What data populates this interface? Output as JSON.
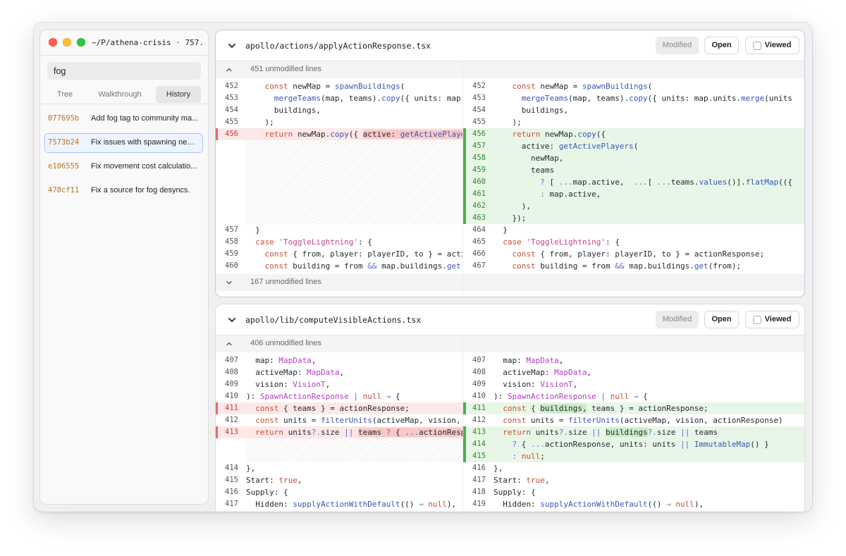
{
  "window": {
    "title": "~/P/athena-crisis · 757..."
  },
  "sidebar": {
    "search_value": "fog",
    "tabs": [
      "Tree",
      "Walkthrough",
      "History"
    ],
    "active_tab": "History",
    "commits": [
      {
        "hash": "077695b",
        "message": "Add fog tag to community ma..."
      },
      {
        "hash": "7573b24",
        "message": "Fix issues with spawning new ..."
      },
      {
        "hash": "e106555",
        "message": "Fix movement cost calculatio..."
      },
      {
        "hash": "470cf11",
        "message": "Fix a source for fog desyncs."
      }
    ],
    "selected_commit": "7573b24"
  },
  "files": [
    {
      "path": "apollo/actions/applyActionResponse.tsx",
      "status": "Modified",
      "open_label": "Open",
      "viewed_label": "Viewed",
      "fold_top": "451 unmodified lines",
      "fold_bottom": "167 unmodified lines",
      "left": [
        {
          "n": "452",
          "type": "ctx",
          "html": "    <span class='k'>const</span> newMap = <span class='f'>spawnBuildings</span>("
        },
        {
          "n": "453",
          "type": "ctx",
          "html": "      <span class='f'>mergeTeams</span>(map, teams).<span class='f'>copy</span>({ units: map.units.merge("
        },
        {
          "n": "454",
          "type": "ctx",
          "html": "      buildings,"
        },
        {
          "n": "455",
          "type": "ctx",
          "html": "    );"
        },
        {
          "n": "456",
          "type": "del",
          "html": "    <span class='k'>return</span> newMap.<span class='f'>copy</span>({ <span class='hlr'>active: <span class='f'>getActivePlayers</span></span>"
        },
        {
          "n": "",
          "type": "empty",
          "html": ""
        },
        {
          "n": "",
          "type": "empty",
          "html": ""
        },
        {
          "n": "",
          "type": "empty",
          "html": ""
        },
        {
          "n": "",
          "type": "empty",
          "html": ""
        },
        {
          "n": "",
          "type": "empty",
          "html": ""
        },
        {
          "n": "",
          "type": "empty",
          "html": ""
        },
        {
          "n": "",
          "type": "empty",
          "html": ""
        },
        {
          "n": "457",
          "type": "ctx",
          "html": "  }"
        },
        {
          "n": "458",
          "type": "ctx",
          "html": "  <span class='k'>case</span> <span class='s'>'ToggleLightning'</span>: {"
        },
        {
          "n": "459",
          "type": "ctx",
          "html": "    <span class='k'>const</span> { from, player: playerID, to } = actionResponse;"
        },
        {
          "n": "460",
          "type": "ctx",
          "html": "    <span class='k'>const</span> building = from <span class='o'>&amp;&amp;</span> map.buildings.<span class='f'>get</span>(from);"
        }
      ],
      "right": [
        {
          "n": "452",
          "type": "ctx",
          "html": "    <span class='k'>const</span> newMap = <span class='f'>spawnBuildings</span>("
        },
        {
          "n": "453",
          "type": "ctx",
          "html": "      <span class='f'>mergeTeams</span>(map, teams).<span class='f'>copy</span>({ units: map.units.<span class='f'>merge</span>(units"
        },
        {
          "n": "454",
          "type": "ctx",
          "html": "      buildings,"
        },
        {
          "n": "455",
          "type": "ctx",
          "html": "    );"
        },
        {
          "n": "456",
          "type": "add",
          "html": "    <span class='k'>return</span> newMap.<span class='f'>copy</span>({"
        },
        {
          "n": "457",
          "type": "add",
          "html": "      active: <span class='f'>getActivePlayers</span>("
        },
        {
          "n": "458",
          "type": "add",
          "html": "        newMap,"
        },
        {
          "n": "459",
          "type": "add",
          "html": "        teams"
        },
        {
          "n": "460",
          "type": "add",
          "html": "          <span class='o'>?</span> [ <span class='o'>...</span>map.active,  <span class='o'>...</span>[ <span class='o'>...</span>teams.<span class='f'>values</span>()].<span class='f'>flatMap</span>(({"
        },
        {
          "n": "461",
          "type": "add",
          "html": "          <span class='o'>:</span> map.active,"
        },
        {
          "n": "462",
          "type": "add",
          "html": "      ),"
        },
        {
          "n": "463",
          "type": "add",
          "html": "    });"
        },
        {
          "n": "464",
          "type": "ctx",
          "html": "  }"
        },
        {
          "n": "465",
          "type": "ctx",
          "html": "  <span class='k'>case</span> <span class='s'>'ToggleLightning'</span>: {"
        },
        {
          "n": "466",
          "type": "ctx",
          "html": "    <span class='k'>const</span> { from, player: playerID, to } = actionResponse;"
        },
        {
          "n": "467",
          "type": "ctx",
          "html": "    <span class='k'>const</span> building = from <span class='o'>&amp;&amp;</span> map.buildings.<span class='f'>get</span>(from);"
        }
      ]
    },
    {
      "path": "apollo/lib/computeVisibleActions.tsx",
      "status": "Modified",
      "open_label": "Open",
      "viewed_label": "Viewed",
      "fold_top": "406 unmodified lines",
      "fold_bottom": "",
      "left": [
        {
          "n": "407",
          "type": "ctx",
          "html": "  map: <span class='t'>MapData</span>,"
        },
        {
          "n": "408",
          "type": "ctx",
          "html": "  activeMap: <span class='t'>MapData</span>,"
        },
        {
          "n": "409",
          "type": "ctx",
          "html": "  vision: <span class='t'>VisionT</span>,"
        },
        {
          "n": "410",
          "type": "ctx",
          "html": "): <span class='t'>SpawnActionResponse</span> <span class='o'>|</span> <span class='k'>null</span> <span class='o'>⇒</span> {"
        },
        {
          "n": "411",
          "type": "del",
          "html": "  <span class='k'>const</span> { teams } = actionResponse;"
        },
        {
          "n": "412",
          "type": "ctx",
          "html": "  <span class='k'>const</span> units = <span class='f'>filterUnits</span>(activeMap, vision, actionRes"
        },
        {
          "n": "413",
          "type": "del",
          "html": "  <span class='k'>return</span> units<span class='o'>?.</span>size <span class='o'>||</span> <span class='hlr'>teams <span class='o'>?</span> { <span class='o'>...</span>actionResponse</span>"
        },
        {
          "n": "",
          "type": "empty",
          "html": ""
        },
        {
          "n": "",
          "type": "empty",
          "html": ""
        },
        {
          "n": "414",
          "type": "ctx",
          "html": "},"
        },
        {
          "n": "415",
          "type": "ctx",
          "html": "Start: <span class='k'>true</span>,"
        },
        {
          "n": "416",
          "type": "ctx",
          "html": "Supply: {"
        },
        {
          "n": "417",
          "type": "ctx",
          "html": "  Hidden: <span class='f'>supplyActionWithDefault</span>(() <span class='o'>⇒</span> <span class='k'>null</span>),"
        }
      ],
      "right": [
        {
          "n": "407",
          "type": "ctx",
          "html": "  map: <span class='t'>MapData</span>,"
        },
        {
          "n": "408",
          "type": "ctx",
          "html": "  activeMap: <span class='t'>MapData</span>,"
        },
        {
          "n": "409",
          "type": "ctx",
          "html": "  vision: <span class='t'>VisionT</span>,"
        },
        {
          "n": "410",
          "type": "ctx",
          "html": "): <span class='t'>SpawnActionResponse</span> <span class='o'>|</span> <span class='k'>null</span> <span class='o'>⇒</span> {"
        },
        {
          "n": "411",
          "type": "add",
          "html": "  <span class='k'>const</span> { <span class='hlg'>buildings,</span> teams } = actionResponse;"
        },
        {
          "n": "412",
          "type": "ctx",
          "html": "  <span class='k'>const</span> units = <span class='f'>filterUnits</span>(activeMap, vision, actionResponse)"
        },
        {
          "n": "413",
          "type": "add",
          "html": "  <span class='k'>return</span> units<span class='o'>?.</span>size <span class='o'>||</span> <span class='hlg'>buildings</span><span class='o'>?.</span>size <span class='o'>||</span> teams"
        },
        {
          "n": "414",
          "type": "add",
          "html": "    <span class='o'>?</span> { <span class='o'>...</span>actionResponse, units: units <span class='o'>||</span> <span class='f'>ImmutableMap</span>() }"
        },
        {
          "n": "415",
          "type": "add",
          "html": "    <span class='o'>:</span> <span class='k'>null</span>;"
        },
        {
          "n": "416",
          "type": "ctx",
          "html": "},"
        },
        {
          "n": "417",
          "type": "ctx",
          "html": "Start: <span class='k'>true</span>,"
        },
        {
          "n": "418",
          "type": "ctx",
          "html": "Supply: {"
        },
        {
          "n": "419",
          "type": "ctx",
          "html": "  Hidden: <span class='f'>supplyActionWithDefault</span>(() <span class='o'>⇒</span> <span class='k'>null</span>),"
        }
      ]
    }
  ]
}
